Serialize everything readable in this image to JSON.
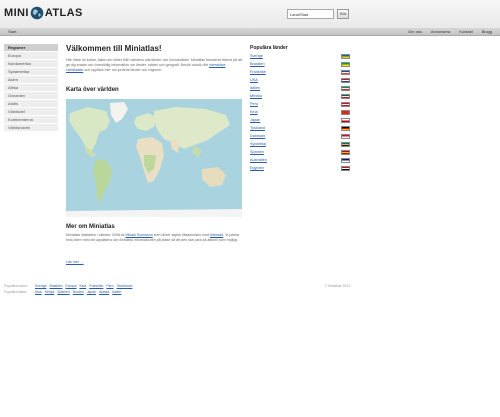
{
  "header": {
    "logo_left": "MINI",
    "logo_right": "ATLAS",
    "search_placeholder": "Land/Stad",
    "search_button": "Sök"
  },
  "navbar": {
    "home": "Start",
    "links": [
      "Om oss",
      "Annonsera",
      "Kontakt",
      "Blogg"
    ]
  },
  "sidebar": {
    "items": [
      "Regioner",
      "Europa",
      "Nordamerika",
      "Sydamerika",
      "Asien",
      "Afrika",
      "Oceanien",
      "Arktis",
      "Världsdel",
      "Kontinenterna",
      "Världshaven"
    ]
  },
  "main": {
    "title": "Välkommen till Miniatlas!",
    "intro_before": "Här hittar du kartor, fakta och bilder från världens alla länder och huvudstäder. Miniatlas fokuserar främst på att ge dig snabb och översiktlig information om länder, städer och geografi. Besök också vårt",
    "intro_link": "interaktiva världsatlas",
    "intro_after": "och upptäck mer om jordens länder och regioner.",
    "map_title": "Karta över världen",
    "about_title": "Mer om Miniatlas",
    "about_before": "Miniatlas startades i oktober 2008 av",
    "about_link1": "Mikael Svensson",
    "about_middle": "som driver sajten tillsammans med",
    "about_link2": "Interadd",
    "about_after": ". Vi jobbar hela tiden med att uppdatera och förbättra informationen på sidan så att den ska vara så aktuell som möjligt.",
    "read_more": "Läs mer →"
  },
  "popular": {
    "title": "Populära länder",
    "countries": [
      {
        "name": "Sverige",
        "colors": [
          "#006aa7",
          "#fecc00"
        ]
      },
      {
        "name": "Brasilien",
        "colors": [
          "#009c3b",
          "#ffdf00"
        ]
      },
      {
        "name": "Frankrike",
        "colors": [
          "#0055a4",
          "#ffffff",
          "#ef4135"
        ]
      },
      {
        "name": "USA",
        "colors": [
          "#b22234",
          "#ffffff",
          "#3c3b6e"
        ]
      },
      {
        "name": "Italien",
        "colors": [
          "#009246",
          "#ffffff",
          "#ce2b37"
        ]
      },
      {
        "name": "Mexiko",
        "colors": [
          "#006847",
          "#ffffff",
          "#ce1126"
        ]
      },
      {
        "name": "Peru",
        "colors": [
          "#d91023",
          "#ffffff",
          "#d91023"
        ]
      },
      {
        "name": "Kina",
        "colors": [
          "#de2910",
          "#de2910"
        ]
      },
      {
        "name": "Japan",
        "colors": [
          "#ffffff",
          "#bc002d"
        ]
      },
      {
        "name": "Tyskland",
        "colors": [
          "#000000",
          "#dd0000",
          "#ffce00"
        ]
      },
      {
        "name": "Danmark",
        "colors": [
          "#c60c30",
          "#ffffff"
        ]
      },
      {
        "name": "Sydafrika",
        "colors": [
          "#007749",
          "#ffb81c",
          "#001489"
        ]
      },
      {
        "name": "Spanien",
        "colors": [
          "#aa151b",
          "#f1bf00",
          "#aa151b"
        ]
      },
      {
        "name": "Australien",
        "colors": [
          "#012169",
          "#ffffff"
        ]
      },
      {
        "name": "Egypten",
        "colors": [
          "#ce1126",
          "#ffffff",
          "#000000"
        ]
      }
    ]
  },
  "footer": {
    "row1_label": "Populära kartor:",
    "row1_links": [
      "Sverige",
      "Brasilien",
      "Europa",
      "Kina",
      "Frankrike",
      "Peru",
      "Stockholm"
    ],
    "row2_label": "Populära fakta:",
    "row2_links": [
      "Asia",
      "Kenya",
      "Spanien",
      "Norden",
      "Japan",
      "Alaska",
      "Italien"
    ],
    "copyright": "© Miniatlas 2013"
  }
}
